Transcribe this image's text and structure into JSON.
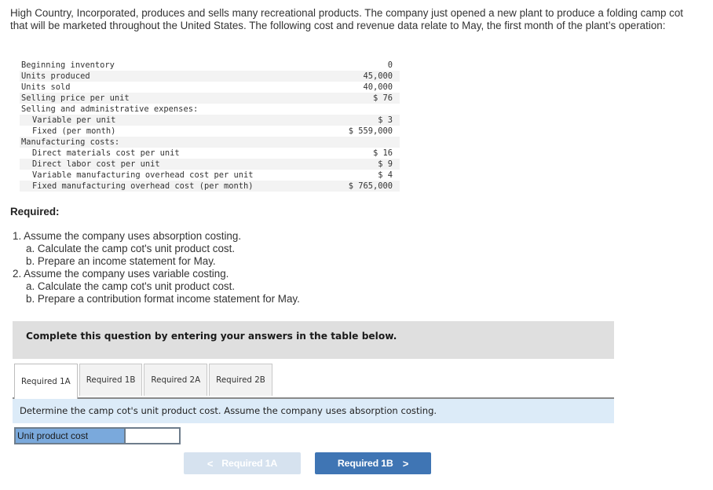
{
  "intro": "High Country, Incorporated, produces and sells many recreational products. The company just opened a new plant to produce a folding camp cot that will be marketed throughout the United States. The following cost and revenue data relate to May, the first month of the plant’s operation:",
  "data_rows": [
    {
      "label": "Beginning inventory",
      "value": "0",
      "indent": 0
    },
    {
      "label": "Units produced",
      "value": "45,000",
      "indent": 0
    },
    {
      "label": "Units sold",
      "value": "40,000",
      "indent": 0
    },
    {
      "label": "Selling price per unit",
      "value": "$ 76",
      "indent": 0
    },
    {
      "label": "Selling and administrative expenses:",
      "value": "",
      "indent": 0
    },
    {
      "label": "Variable per unit",
      "value": "$ 3",
      "indent": 1
    },
    {
      "label": "Fixed (per month)",
      "value": "$ 559,000",
      "indent": 1
    },
    {
      "label": "Manufacturing costs:",
      "value": "",
      "indent": 0
    },
    {
      "label": "Direct materials cost per unit",
      "value": "$ 16",
      "indent": 1
    },
    {
      "label": "Direct labor cost per unit",
      "value": "$ 9",
      "indent": 1
    },
    {
      "label": "Variable manufacturing overhead cost per unit",
      "value": "$ 4",
      "indent": 1
    },
    {
      "label": "Fixed manufacturing overhead cost (per month)",
      "value": "$ 765,000",
      "indent": 1
    }
  ],
  "required": {
    "title": "Required:",
    "items": [
      {
        "text": "1. Assume the company uses absorption costing.",
        "level": 1
      },
      {
        "text": "a. Calculate the camp cot's unit product cost.",
        "level": 2
      },
      {
        "text": "b. Prepare an income statement for May.",
        "level": 2
      },
      {
        "text": "2. Assume the company uses variable costing.",
        "level": 1
      },
      {
        "text": "a. Calculate the camp cot's unit product cost.",
        "level": 2
      },
      {
        "text": "b. Prepare a contribution format income statement for May.",
        "level": 2
      }
    ]
  },
  "instruction": "Complete this question by entering your answers in the table below.",
  "tabs": [
    {
      "label": "Required 1A",
      "active": true
    },
    {
      "label": "Required 1B",
      "active": false
    },
    {
      "label": "Required 2A",
      "active": false
    },
    {
      "label": "Required 2B",
      "active": false
    }
  ],
  "prompt": "Determine the camp cot's unit product cost. Assume the company uses absorption costing.",
  "answer": {
    "label": "Unit product cost",
    "value": ""
  },
  "nav": {
    "prev_label": "Required 1A",
    "prev_icon": "chevron-left-icon",
    "next_label": "Required 1B",
    "next_icon": "chevron-right-icon"
  },
  "colors": {
    "instruction_bg": "#dfdfdf",
    "prompt_bg": "#dcebf8",
    "answer_label_bg": "#7aa9dc",
    "next_button": "#3f75b4",
    "prev_button_disabled": "#d6e2ef"
  }
}
